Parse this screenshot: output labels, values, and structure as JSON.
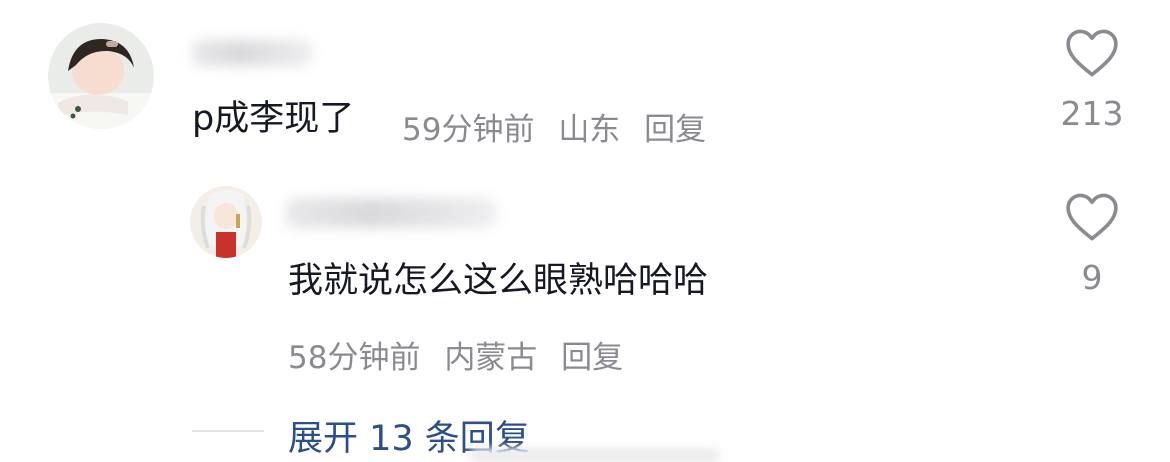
{
  "comments": [
    {
      "text": "p成李现了",
      "time": "59分钟前",
      "location": "山东",
      "reply_label": "回复",
      "like_count": "213"
    },
    {
      "text": "我就说怎么这么眼熟哈哈哈",
      "time": "58分钟前",
      "location": "内蒙古",
      "reply_label": "回复",
      "like_count": "9"
    }
  ],
  "expand": {
    "label": "展开 13 条回复"
  },
  "icons": {
    "like": "heart-outline-icon"
  },
  "colors": {
    "link": "#2b4e8c",
    "meta": "#8a8b91",
    "text": "#161823"
  }
}
